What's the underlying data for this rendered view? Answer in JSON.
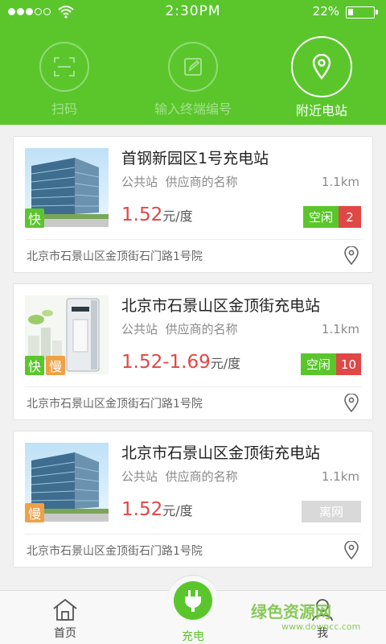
{
  "status_bar": {
    "time": "2:30PM",
    "battery": "22%",
    "battery_level": 0.22
  },
  "tools": {
    "scan": {
      "label": "扫码",
      "icon": "scan-icon"
    },
    "input": {
      "label": "输入终端编号",
      "icon": "edit-icon"
    },
    "nearby": {
      "label": "附近电站",
      "icon": "location-pin-icon"
    }
  },
  "stations": [
    {
      "name": "首钢新园区1号充电站",
      "type": "公共站",
      "supplier": "供应商的名称",
      "distance": "1.1km",
      "price": "1.52",
      "unit": "元/度",
      "badges": {
        "fast": "快"
      },
      "status_label": "空闲",
      "status_count": "2",
      "address": "北京市石景山区金顶街石门路1号院"
    },
    {
      "name": "北京市石景山区金顶街充电站",
      "type": "公共站",
      "supplier": "供应商的名称",
      "distance": "1.1km",
      "price": "1.52-1.69",
      "unit": "元/度",
      "badges": {
        "fast": "快",
        "slow": "慢"
      },
      "status_label": "空闲",
      "status_count": "10",
      "address": "北京市石景山区金顶街石门路1号院"
    },
    {
      "name": "北京市石景山区金顶街充电站",
      "type": "公共站",
      "supplier": "供应商的名称",
      "distance": "1.1km",
      "price": "1.52",
      "unit": "元/度",
      "badges": {
        "slow": "慢"
      },
      "status_label": "离网",
      "address": "北京市石景山区金顶街石门路1号院"
    }
  ],
  "bottom_nav": {
    "home": "首页",
    "charge": "充电",
    "me": "我"
  },
  "watermark": {
    "main": "绿色资源网",
    "sub": "www.downcc.com"
  },
  "colors": {
    "brand_green": "#5ac62c",
    "price_red": "#e04747",
    "slow_orange": "#f0a046",
    "offline_gray": "#d9d9d9"
  }
}
